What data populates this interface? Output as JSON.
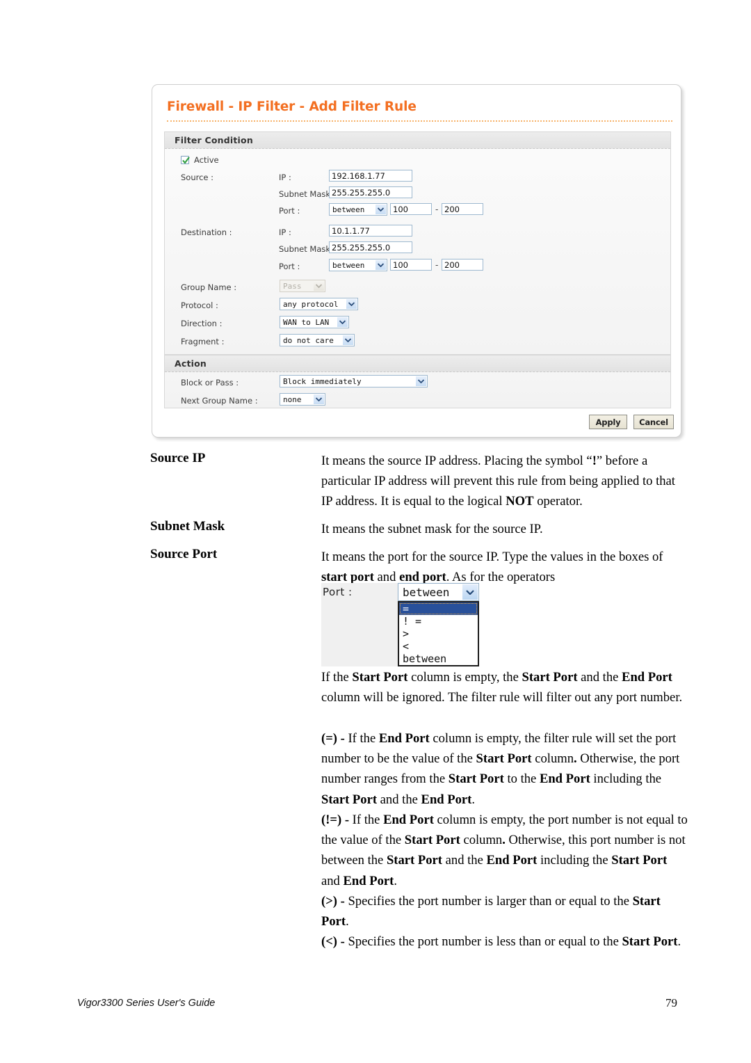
{
  "page": {
    "footer_text": "Vigor3300 Series User's Guide",
    "page_number": "79"
  },
  "screenshot": {
    "title": "Firewall - IP Filter - Add Filter Rule",
    "title_color": "#F36F21",
    "panels": {
      "filter_condition": {
        "heading": "Filter Condition",
        "active_checkbox": {
          "label": "Active",
          "checked": true,
          "check_color": "#2f9e3f"
        },
        "source": {
          "group_label": "Source :",
          "ip_label": "IP :",
          "ip_value": "192.168.1.77",
          "mask_label": "Subnet Mask :",
          "mask_value": "255.255.255.0",
          "port_label": "Port :",
          "port_operator": "between",
          "port_start": "100",
          "port_separator": "-",
          "port_end": "200"
        },
        "destination": {
          "group_label": "Destination :",
          "ip_label": "IP :",
          "ip_value": "10.1.1.77",
          "mask_label": "Subnet Mask :",
          "mask_value": "255.255.255.0",
          "port_label": "Port :",
          "port_operator": "between",
          "port_start": "100",
          "port_separator": "-",
          "port_end": "200"
        },
        "group_name_label": "Group Name :",
        "group_name_value": "Pass",
        "protocol_label": "Protocol :",
        "protocol_value": "any protocol",
        "direction_label": "Direction :",
        "direction_value": "WAN to LAN",
        "fragment_label": "Fragment :",
        "fragment_value": "do not care"
      },
      "action": {
        "heading": "Action",
        "block_or_pass_label": "Block or Pass :",
        "block_or_pass_value": "Block immediately",
        "next_group_name_label": "Next Group Name :",
        "next_group_name_value": "none"
      }
    },
    "buttons": {
      "apply": "Apply",
      "cancel": "Cancel"
    }
  },
  "definitions": [
    {
      "term": "Source IP",
      "html": "It means the source IP address. Placing the symbol &ldquo;<b>!</b>&rdquo; before a particular IP address will prevent this rule from being applied to that IP address. It is equal to the logical <b>NOT</b> operator."
    },
    {
      "term": "Subnet Mask",
      "html": "It means the subnet mask for the source IP."
    },
    {
      "term": "Source Port",
      "html": "It means the port for the source IP. Type the values in the boxes of <b>start port</b> and <b>end port</b>. As for the operators"
    }
  ],
  "operator_figure": {
    "port_label": "Port :",
    "selected_value": "between",
    "options": [
      "=",
      "! =",
      ">",
      "<",
      "between"
    ],
    "highlighted_index": 0,
    "highlight_color": "#28509a"
  },
  "operator_notes": [
    "If the <b>Start Port</b> column is empty, the <b>Start Port</b> and the <b>End Port</b> column will be ignored. The filter rule will filter out any port number.",
    "<b>(=) -</b> If the <b>End Port</b> column is empty, the filter rule will set the port number to be the value of the <b>Start Port</b> column<b>.</b> Otherwise, the port number ranges from the <b>Start Port</b> to the <b>End Port</b> including the <b>Start Port</b> and the <b>End Port</b>.",
    "<b>(!=) -</b> If the <b>End Port</b> column is empty, the port number is not equal to the value of the <b>Start Port</b> column<b>.</b> Otherwise, this port number is not between the <b>Start Port</b> and the <b>End Port</b> including the <b>Start Port</b> and <b>End Port</b>.",
    "<b>(&gt;) -</b> Specifies the port number is larger than or equal to the <b>Start Port</b>.",
    "<b>(&lt;) -</b> Specifies the port number is less than or equal to the <b>Start Port</b>."
  ]
}
